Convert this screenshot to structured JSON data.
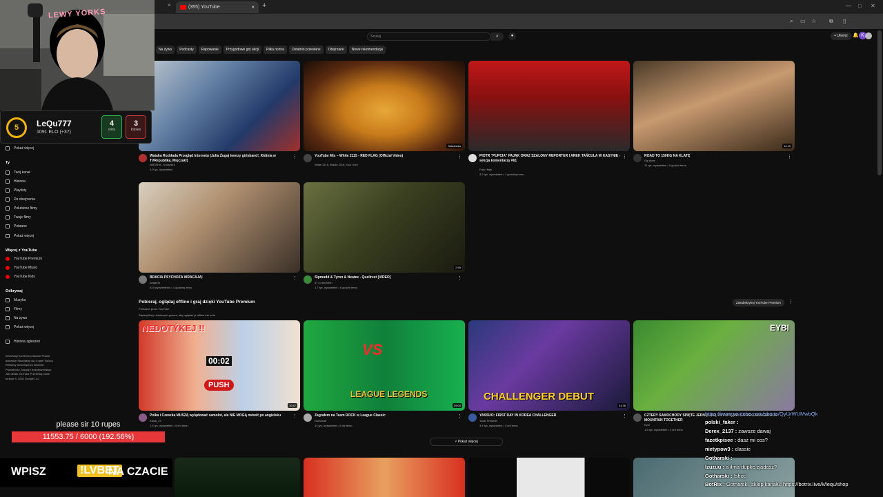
{
  "browser": {
    "tab_title": "(355) YouTube",
    "new_tab": "+",
    "close": "×"
  },
  "youtube": {
    "search_placeholder": "Szukaj",
    "create_label": "+ Utwórz",
    "chips": [
      "Na żywo",
      "Podcasty",
      "Rapowanie",
      "Przygodowe gry akcji",
      "Piłka nożna",
      "Ostatnio przesłane",
      "Obejrzane",
      "Nowe rekomendacje"
    ],
    "sidebar": {
      "show_more_1": "Pokaż więcej",
      "you_heading": "Ty",
      "you_items": [
        "Twój kanał",
        "Historia",
        "Playlisty",
        "Do obejrzenia",
        "Polubione filmy",
        "Twoje filmy",
        "Pobrane",
        "Pokaż więcej"
      ],
      "more_heading": "Więcej z YouTube",
      "more_items": [
        "YouTube Premium",
        "YouTube Music",
        "YouTube Kids"
      ],
      "explore_heading": "Odkrywaj",
      "explore_items": [
        "Muzyka",
        "Filmy",
        "Na żywo",
        "Pokaż więcej"
      ],
      "report": "Historia zgłoszeń",
      "footer": "Informacje  Centrum prasowe  Prawa autorskie  Skontaktuj się z nami  Twórcy  Reklamy  Deweloperzy  Warunki  Prywatność  Zasady i bezpieczeństwo  Jak działa YouTube  Przetestuj nowe funkcje  © 2026 Google LLC"
    },
    "videos_row1": [
      {
        "title": "Wataha Rozkłada Przegląd Internetu (Julia Żugaj tworzy girlsband!, Kłótnia w TVRepublika, Mięczak!)",
        "channel": "WATAHA - Kruluzbro",
        "meta": "4,9 tys. wyświetleń",
        "dur": ""
      },
      {
        "title": "YouTube Mix – White 2115 - RED FLAG (Official Video)",
        "channel": "White 2115, Bracia 2115, Kizo i inni",
        "meta": "",
        "dur": "Składanka"
      },
      {
        "title": "PIOTR \"PUPCIA\" PAJĄK ORAZ SZALONY REPORTER I AREK TAŃCULA W KASYNIE - sekcja komentarzy #61",
        "channel": "Fala Hejtu",
        "meta": "3,2 tys. wyświetleń • 1 godzinę temu",
        "dur": ""
      },
      {
        "title": "ROAD TO 150KG NA KLATĘ",
        "channel": "Gg sikee",
        "meta": "21 tys. wyświetleń • 5 godzin temu",
        "dur": "14:19"
      }
    ],
    "videos_row2": [
      {
        "title": "BRACIA PSYCHOZA WRACAJĄ!",
        "channel": "AngikOk",
        "meta": "624 wyświetlenia • 1 godzinę temu",
        "dur": ""
      },
      {
        "title": "Sipmudd & Tyron & Neatee - Quellrest [VIDEO]",
        "channel": "37 in this bitch",
        "meta": "1,7 tys. wyświetleń • 6 godzin temu",
        "dur": "2:55"
      }
    ],
    "premium_section": {
      "title": "Pobieraj, oglądaj offline i graj dzięki YouTube Premium",
      "sub1": "Polecane przez YouTube",
      "sub2": "Zapisuj filmy ulubionych gracza, aby oglądać je offline lub w tle",
      "subscribe": "Zasubskrybuj YouTube Premium",
      "show_more": "Pokaż więcej"
    },
    "videos_row3": [
      {
        "title": "Polka i Czeszka MUSZĄ wylądować samolot, ale NIE MOGĄ mówić po angielsku",
        "channel": "Kasia_23",
        "meta": "1,4 tys. wyświetleń • 4 dni temu",
        "dur": "10:47",
        "thumb_text": "NEDOTÝKEJ !!",
        "timer": "00:02",
        "push": "PUSH"
      },
      {
        "title": "Zagrałem na Team ROCK w League Classic",
        "channel": "Domnnak",
        "meta": "14 tys. wyświetleń • 4 dni temu",
        "dur": "29:00",
        "thumb_text": "LEAGUE LEGENDS",
        "vs": "VS"
      },
      {
        "title": "YASSUO: FIRST DAY IN KOREA CHALLENGER",
        "channel": "Yassi Tempest",
        "meta": "3,4 tys. wyświetleń • 4 dni temu",
        "dur": "24:38",
        "thumb_text": "CHALLENGER DEBUT"
      },
      {
        "title": "CZTERY SAMOCHODY SPIĘTE JEDNĄ LINĄ VS POTĘŻNY GÓRSKI DANGEROUS MOUNTAIN TOGETHER",
        "channel": "Eybi",
        "meta": "1,6 tys. wyświetleń • 4 dni temu",
        "dur": "",
        "thumb_text": "EYBI"
      }
    ]
  },
  "stream": {
    "elo": {
      "rank": "5",
      "name": "LeQu777",
      "elo": "1091 ELO (+37)",
      "wins": "4",
      "wins_label": "wins",
      "losses": "3",
      "losses_label": "losses"
    },
    "goal_text": "please sir 10 rupes",
    "goal_value": "11553.75 / 6000 (192.56%)",
    "promo_a": "WPISZ",
    "promo_b": "!LVBET",
    "promo_c": "NA CZACIE",
    "chat": [
      {
        "user": "",
        "msg": "https://www.youtube.com/shorts/QyUrWUMwbQk",
        "color": "#8cb4ff",
        "link": true
      },
      {
        "user": "polski_faker :",
        "msg": "",
        "color": "#ffffff"
      },
      {
        "user": "Derex_2137 :",
        "msg": "zawsze dawaj",
        "color": "#ffffff"
      },
      {
        "user": "fazetkpisee :",
        "msg": "dasz mi cos?",
        "color": "#ffffff"
      },
      {
        "user": "nietypow3 :",
        "msg": "classic",
        "color": "#ffffff"
      },
      {
        "user": "Gotharski :",
        "msg": "",
        "color": "#ffffff"
      },
      {
        "user": "lzuzuu :",
        "msg": "a ilma dupke zjadasz?",
        "color": "#ffffff"
      },
      {
        "user": "Gotharski :",
        "msg": "!shop",
        "color": "#ffffff"
      },
      {
        "user": "BotRix :",
        "msg": "Gotharski, sklep kanału: https://botrix.live/k/lequ/shop",
        "color": "#ffffff"
      }
    ]
  }
}
